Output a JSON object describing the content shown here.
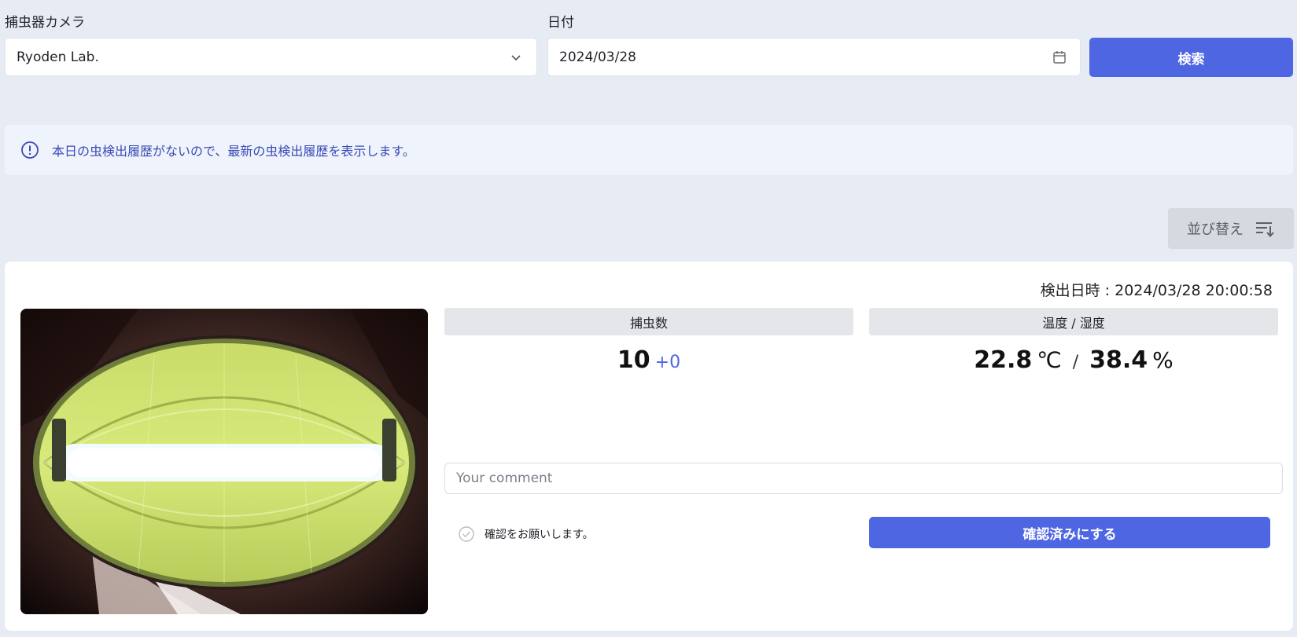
{
  "filters": {
    "camera_label": "捕虫器カメラ",
    "camera_value": "Ryoden Lab.",
    "date_label": "日付",
    "date_value": "2024/03/28",
    "search_label": "検索"
  },
  "alert": {
    "message": "本日の虫検出履歴がないので、最新の虫検出履歴を表示します。"
  },
  "sort": {
    "label": "並び替え"
  },
  "record": {
    "detect_time": "検出日時 : 2024/03/28 20:00:58",
    "catch_header": "捕虫数",
    "catch_count": "10",
    "catch_delta": "+0",
    "env_header": "温度 / 湿度",
    "temperature": "22.8",
    "temperature_unit": "℃",
    "separator": "/",
    "humidity": "38.4",
    "humidity_unit": "%",
    "comment_placeholder": "Your comment",
    "check_label": "確認をお願いします。",
    "confirm_button": "確認済みにする"
  },
  "colors": {
    "primary": "#4f66e3",
    "background": "#e7ebf3",
    "alert_text": "#3c4bb5",
    "alert_bg": "#eef3fc"
  },
  "icons": [
    "chevron-down-icon",
    "calendar-icon",
    "info-icon",
    "sort-icon",
    "check-circle-icon"
  ]
}
